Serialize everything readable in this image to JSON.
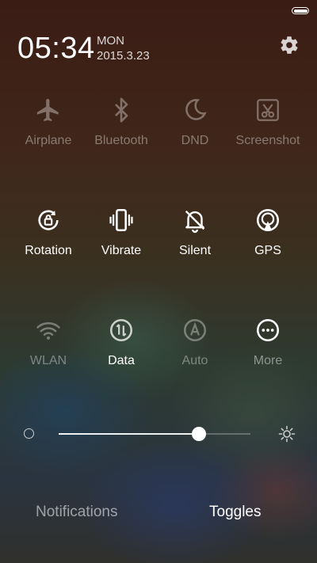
{
  "status_bar": {
    "battery_icon": "battery-icon"
  },
  "header": {
    "time": "05:34",
    "day": "MON",
    "date": "2015.3.23",
    "settings_icon": "gear-icon"
  },
  "toggles": [
    {
      "label": "Airplane",
      "icon": "airplane-icon",
      "state": "off"
    },
    {
      "label": "Bluetooth",
      "icon": "bluetooth-icon",
      "state": "off"
    },
    {
      "label": "DND",
      "icon": "moon-icon",
      "state": "off"
    },
    {
      "label": "Screenshot",
      "icon": "scissors-icon",
      "state": "off"
    },
    {
      "label": "Rotation",
      "icon": "rotation-lock-icon",
      "state": "on"
    },
    {
      "label": "Vibrate",
      "icon": "vibrate-icon",
      "state": "on"
    },
    {
      "label": "Silent",
      "icon": "bell-off-icon",
      "state": "on"
    },
    {
      "label": "GPS",
      "icon": "location-icon",
      "state": "on"
    },
    {
      "label": "WLAN",
      "icon": "wifi-icon",
      "state": "off"
    },
    {
      "label": "Data",
      "icon": "data-arrows-icon",
      "state": "on"
    },
    {
      "label": "Auto",
      "icon": "auto-brightness-icon",
      "state": "off"
    },
    {
      "label": "More",
      "icon": "more-dots-icon",
      "state": "on"
    }
  ],
  "brightness": {
    "level_percent": 73,
    "low_icon": "brightness-low-icon",
    "high_icon": "brightness-high-icon"
  },
  "tabs": {
    "notifications": "Notifications",
    "toggles": "Toggles",
    "active": "toggles"
  }
}
